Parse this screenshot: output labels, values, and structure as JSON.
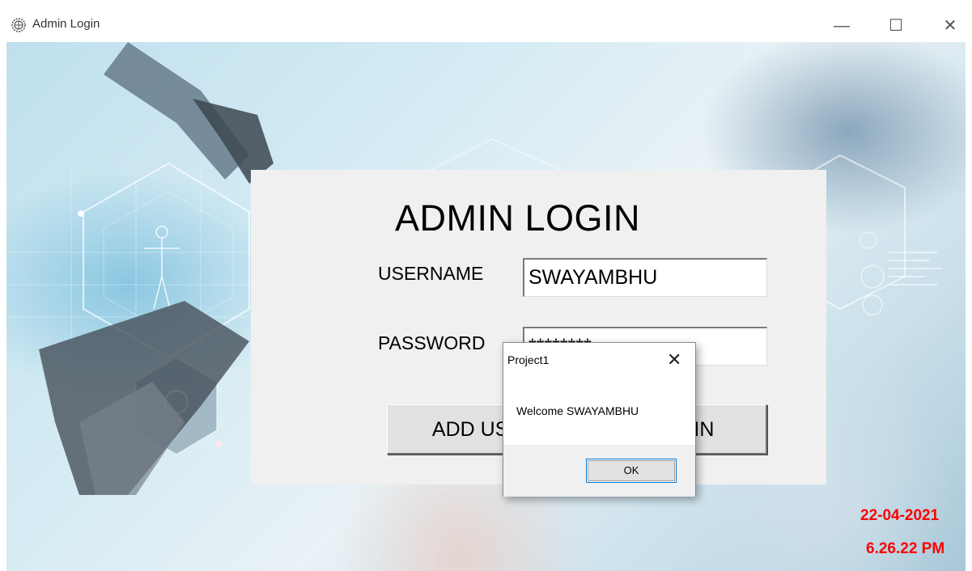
{
  "window": {
    "title": "Admin Login",
    "icon": "gear-globe-icon",
    "controls": {
      "minimize": "—",
      "maximize": "☐",
      "close": "✕"
    }
  },
  "login": {
    "heading": "ADMIN LOGIN",
    "username_label": "USERNAME",
    "username_value": "SWAYAMBHU",
    "password_label": "PASSWORD",
    "password_value": "********",
    "add_user_button": "ADD USER",
    "login_button": "LOGIN"
  },
  "dialog": {
    "title": "Project1",
    "close": "✕",
    "message": "Welcome SWAYAMBHU",
    "ok_button": "OK"
  },
  "status": {
    "date": "22-04-2021",
    "time": "6.26.22 PM",
    "color": "#ff0000"
  }
}
